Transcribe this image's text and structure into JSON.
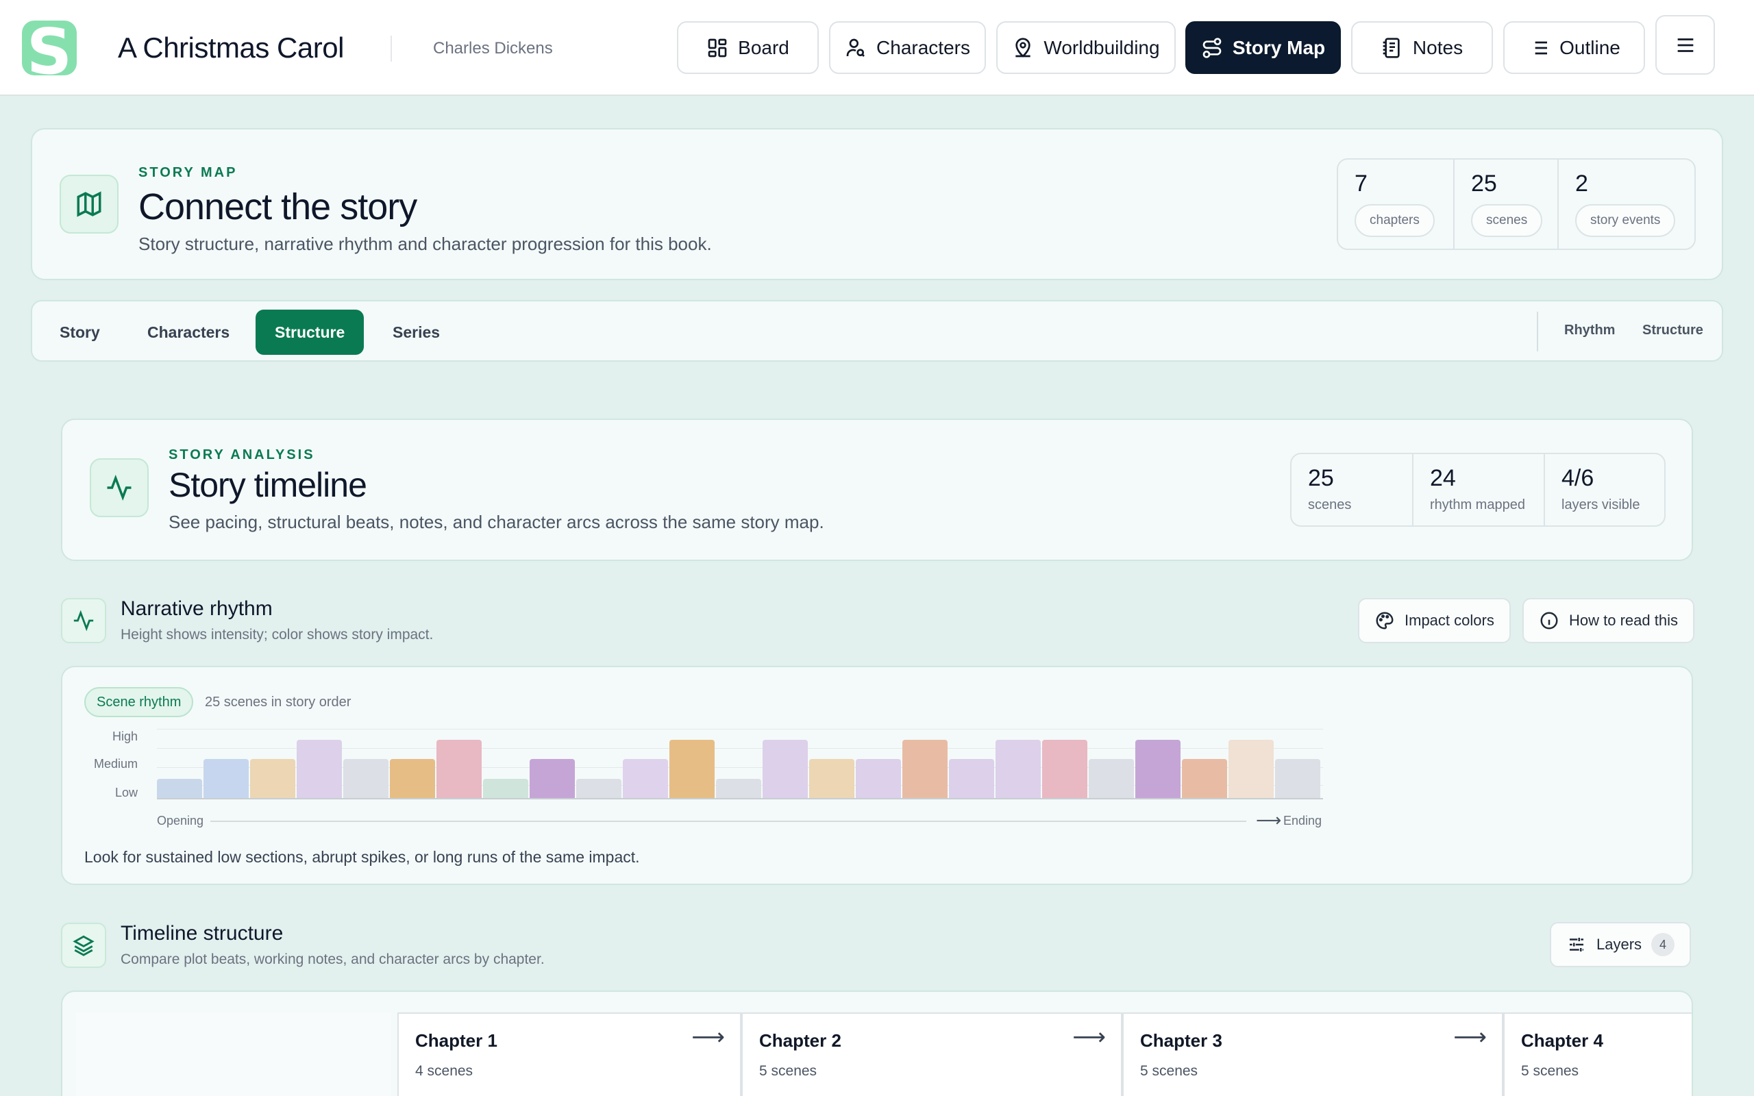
{
  "app": {
    "title": "A Christmas Carol",
    "author": "Charles Dickens",
    "logo_letter": "S"
  },
  "nav": [
    {
      "label": "Board",
      "icon": "grid-icon",
      "active": false
    },
    {
      "label": "Characters",
      "icon": "user-search-icon",
      "active": false
    },
    {
      "label": "Worldbuilding",
      "icon": "map-pin-user-icon",
      "active": false
    },
    {
      "label": "Story Map",
      "icon": "route-icon",
      "active": true
    },
    {
      "label": "Notes",
      "icon": "notebook-icon",
      "active": false
    },
    {
      "label": "Outline",
      "icon": "list-icon",
      "active": false
    }
  ],
  "hero": {
    "eyebrow": "STORY MAP",
    "title": "Connect the story",
    "subtitle": "Story structure, narrative rhythm and character progression for this book.",
    "stats": [
      {
        "value": "7",
        "label": "chapters"
      },
      {
        "value": "25",
        "label": "scenes"
      },
      {
        "value": "2",
        "label": "story events"
      }
    ]
  },
  "tabs": {
    "items": [
      {
        "label": "Story",
        "active": false
      },
      {
        "label": "Characters",
        "active": false
      },
      {
        "label": "Structure",
        "active": true
      },
      {
        "label": "Series",
        "active": false
      }
    ],
    "right": [
      "Rhythm",
      "Structure"
    ]
  },
  "analysis": {
    "eyebrow": "STORY ANALYSIS",
    "title": "Story timeline",
    "subtitle": "See pacing, structural beats, notes, and character arcs across the same story map.",
    "stats": [
      {
        "value": "25",
        "label": "scenes"
      },
      {
        "value": "24",
        "label": "rhythm mapped"
      },
      {
        "value": "4/6",
        "label": "layers visible"
      }
    ]
  },
  "rhythm": {
    "title": "Narrative rhythm",
    "subtitle": "Height shows intensity; color shows story impact.",
    "btn_colors": "Impact colors",
    "btn_help": "How to read this",
    "chip": "Scene rhythm",
    "chip_note": "25 scenes in story order",
    "levels": [
      "High",
      "Medium",
      "Low"
    ],
    "axis_start": "Opening",
    "axis_end": "Ending",
    "note": "Look for sustained low sections, abrupt spikes, or long runs of the same impact."
  },
  "chart_data": {
    "type": "bar",
    "x": [
      1,
      2,
      3,
      4,
      5,
      6,
      7,
      8,
      9,
      10,
      11,
      12,
      13,
      14,
      15,
      16,
      17,
      18,
      19,
      20,
      21,
      22,
      23,
      24,
      25
    ],
    "values": [
      1,
      2,
      2,
      3,
      2,
      2,
      3,
      1,
      2,
      1,
      2,
      3,
      1,
      3,
      2,
      2,
      3,
      2,
      3,
      3,
      2,
      3,
      2,
      3,
      2
    ],
    "colors": [
      "#c9d7ea",
      "#c6d6ee",
      "#ecd6b4",
      "#dcd0ea",
      "#dcdfe5",
      "#e7bd86",
      "#e8b8c3",
      "#cfe4da",
      "#c5a5d6",
      "#dcdfe5",
      "#dfd2ec",
      "#e7bd86",
      "#dcdfe5",
      "#dcd0ea",
      "#ecd6b4",
      "#dcd0ea",
      "#e8bca4",
      "#dcd0ea",
      "#dcd0ea",
      "#e8b8c3",
      "#dcdfe5",
      "#c5a5d6",
      "#e8bca4",
      "#f0e1d4",
      "#dcdfe5"
    ],
    "y_levels": [
      "Low",
      "Medium",
      "High"
    ],
    "ylim": [
      0,
      3
    ]
  },
  "timeline": {
    "title": "Timeline structure",
    "subtitle": "Compare plot beats, working notes, and character arcs by chapter.",
    "layers_label": "Layers",
    "layers_count": "4",
    "chapters": [
      {
        "title": "Chapter 1",
        "scenes": "4 scenes"
      },
      {
        "title": "Chapter 2",
        "scenes": "5 scenes"
      },
      {
        "title": "Chapter 3",
        "scenes": "5 scenes"
      },
      {
        "title": "Chapter 4",
        "scenes": "5 scenes"
      }
    ]
  }
}
